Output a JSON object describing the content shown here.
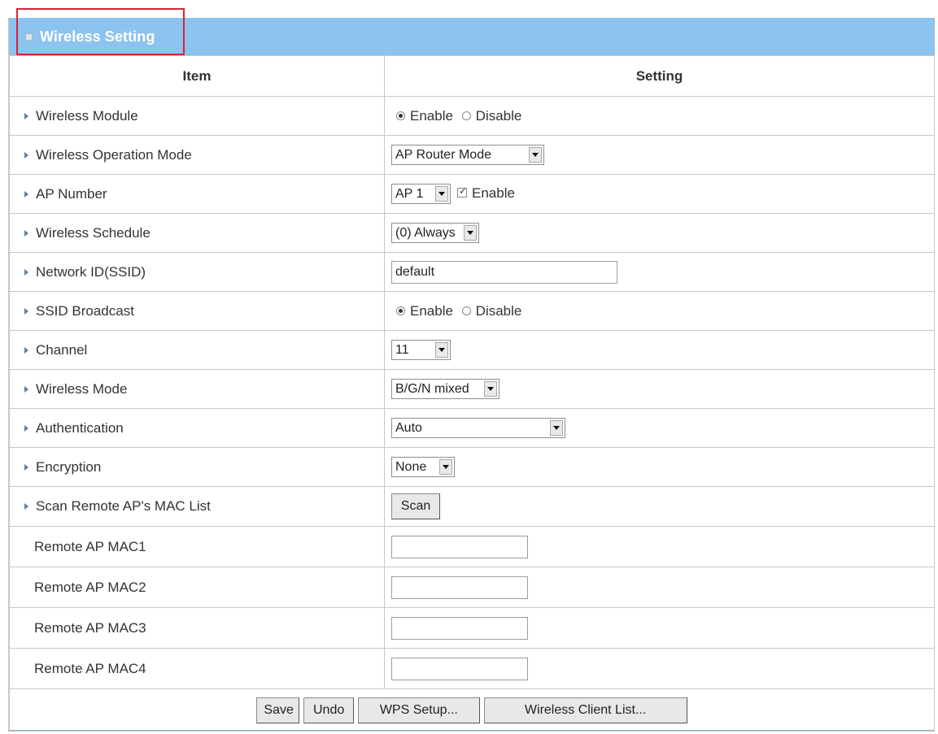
{
  "panel": {
    "title": "Wireless Setting"
  },
  "header": {
    "item": "Item",
    "setting": "Setting"
  },
  "rows": {
    "wireless_module": {
      "label": "Wireless Module",
      "opt_enable": "Enable",
      "opt_disable": "Disable",
      "selected": "Enable"
    },
    "operation_mode": {
      "label": "Wireless Operation Mode",
      "value": "AP Router Mode"
    },
    "ap_number": {
      "label": "AP Number",
      "value": "AP 1",
      "checkbox_label": "Enable",
      "checked": true
    },
    "schedule": {
      "label": "Wireless Schedule",
      "value": "(0) Always"
    },
    "ssid": {
      "label": "Network ID(SSID)",
      "value": "default"
    },
    "ssid_broadcast": {
      "label": "SSID Broadcast",
      "opt_enable": "Enable",
      "opt_disable": "Disable",
      "selected": "Enable"
    },
    "channel": {
      "label": "Channel",
      "value": "11"
    },
    "wireless_mode": {
      "label": "Wireless Mode",
      "value": "B/G/N mixed"
    },
    "authentication": {
      "label": "Authentication",
      "value": "Auto"
    },
    "encryption": {
      "label": "Encryption",
      "value": "None"
    },
    "scan": {
      "label": "Scan Remote AP's MAC List",
      "button": "Scan"
    },
    "mac1": {
      "label": "Remote AP MAC1",
      "value": ""
    },
    "mac2": {
      "label": "Remote AP MAC2",
      "value": ""
    },
    "mac3": {
      "label": "Remote AP MAC3",
      "value": ""
    },
    "mac4": {
      "label": "Remote AP MAC4",
      "value": ""
    }
  },
  "buttons": {
    "save": "Save",
    "undo": "Undo",
    "wps": "WPS Setup...",
    "client_list": "Wireless Client List..."
  },
  "colors": {
    "titlebar": "#8cc3ef",
    "highlight_box": "#d7262e",
    "border": "#c8c8c8"
  }
}
